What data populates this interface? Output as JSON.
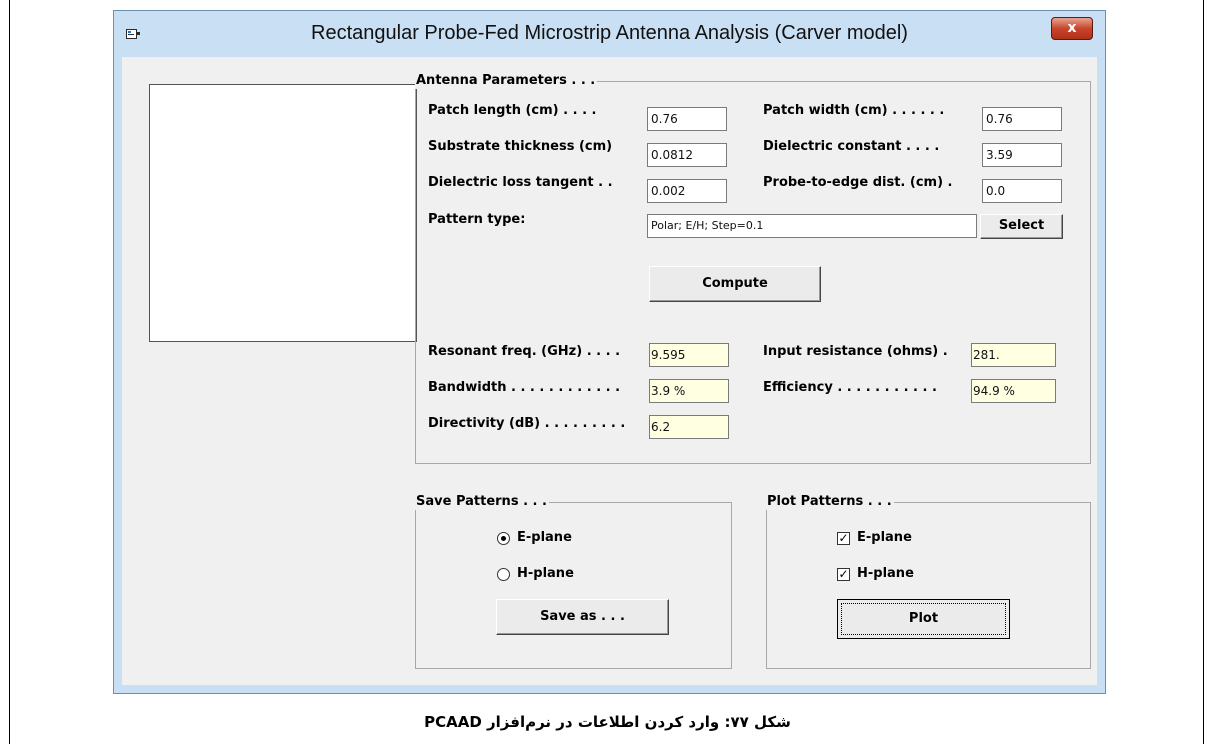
{
  "window": {
    "title": "Rectangular Probe-Fed Microstrip Antenna Analysis (Carver model)",
    "close_glyph": "x"
  },
  "antenna": {
    "group_title": "Antenna Parameters . . .",
    "patch_length": {
      "label": "Patch length (cm) . . . .",
      "value": "0.76"
    },
    "patch_width": {
      "label": "Patch width (cm) . . . . . .",
      "value": "0.76"
    },
    "substrate_thickness": {
      "label": "Substrate thickness (cm)",
      "value": "0.0812"
    },
    "dielectric_constant": {
      "label": "Dielectric constant . . . .",
      "value": "3.59"
    },
    "loss_tangent": {
      "label": "Dielectric loss tangent . .",
      "value": "0.002"
    },
    "probe_edge": {
      "label": "Probe-to-edge dist. (cm) .",
      "value": "0.0"
    },
    "pattern_type": {
      "label": "Pattern type:",
      "value": "Polar; E/H; Step=0.1"
    },
    "select_label": "Select",
    "compute_label": "Compute"
  },
  "results": {
    "resonant_freq": {
      "label": "Resonant freq. (GHz) . . . .",
      "value": "9.595"
    },
    "input_resistance": {
      "label": "Input resistance (ohms) .",
      "value": "281."
    },
    "bandwidth": {
      "label": "Bandwidth . . . . . . . . . . . .",
      "value": "3.9 %"
    },
    "efficiency": {
      "label": "Efficiency . . . . . . . . . . .",
      "value": "94.9 %"
    },
    "directivity": {
      "label": "Directivity (dB) . . . . . . . . .",
      "value": "6.2"
    }
  },
  "save": {
    "group_title": "Save Patterns . . .",
    "e_plane": {
      "label": "E-plane",
      "selected": true
    },
    "h_plane": {
      "label": "H-plane",
      "selected": false
    },
    "save_as_label": "Save as . . ."
  },
  "plot": {
    "group_title": "Plot Patterns . . .",
    "e_plane": {
      "label": "E-plane",
      "checked": true
    },
    "h_plane": {
      "label": "H-plane",
      "checked": true
    },
    "plot_label": "Plot"
  },
  "caption": "شکل ۷۷: وارد کردن اطلاعات در نرم‌افزار PCAAD",
  "colors": {
    "output_bg": "#ffffe1",
    "close_red": "#c8452c",
    "frame_blue": "#c9dff3"
  }
}
